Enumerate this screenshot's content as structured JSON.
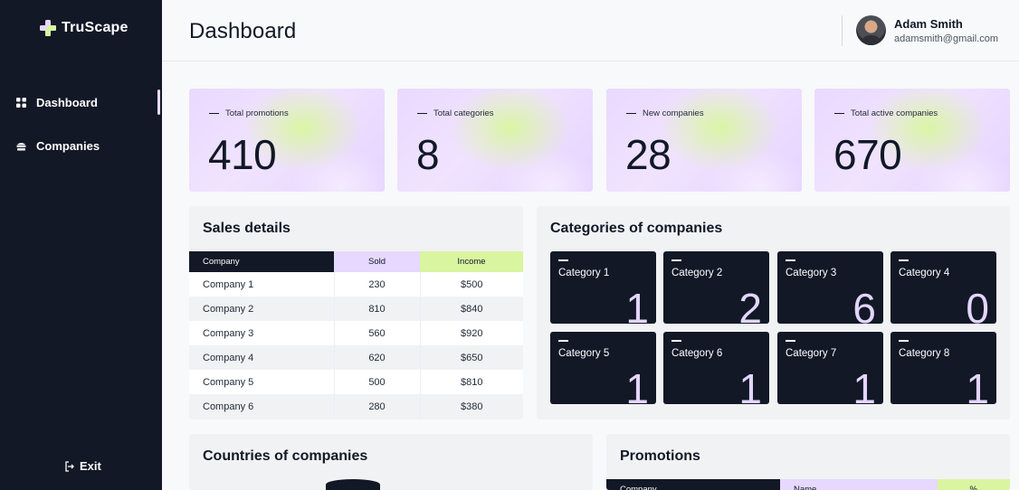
{
  "brand": {
    "name": "TruScape"
  },
  "sidebar": {
    "items": [
      {
        "label": "Dashboard",
        "icon": "grid-icon",
        "active": true
      },
      {
        "label": "Companies",
        "icon": "building-icon",
        "active": false
      }
    ],
    "exit_label": "Exit"
  },
  "header": {
    "title": "Dashboard",
    "user": {
      "name": "Adam Smith",
      "email": "adamsmith@gmail.com"
    }
  },
  "stats": [
    {
      "label": "Total promotions",
      "value": "410"
    },
    {
      "label": "Total categories",
      "value": "8"
    },
    {
      "label": "New companies",
      "value": "28"
    },
    {
      "label": "Total active companies",
      "value": "670"
    }
  ],
  "sales": {
    "title": "Sales details",
    "columns": [
      "Company",
      "Sold",
      "Income"
    ],
    "rows": [
      [
        "Company 1",
        "230",
        "$500"
      ],
      [
        "Company 2",
        "810",
        "$840"
      ],
      [
        "Company 3",
        "560",
        "$920"
      ],
      [
        "Company 4",
        "620",
        "$650"
      ],
      [
        "Company 5",
        "500",
        "$810"
      ],
      [
        "Company 6",
        "280",
        "$380"
      ]
    ]
  },
  "categories": {
    "title": "Categories of companies",
    "items": [
      {
        "label": "Category 1",
        "value": "1"
      },
      {
        "label": "Category 2",
        "value": "2"
      },
      {
        "label": "Category 3",
        "value": "6"
      },
      {
        "label": "Category 4",
        "value": "0"
      },
      {
        "label": "Category 5",
        "value": "1"
      },
      {
        "label": "Category 6",
        "value": "1"
      },
      {
        "label": "Category 7",
        "value": "1"
      },
      {
        "label": "Category 8",
        "value": "1"
      }
    ]
  },
  "countries": {
    "title": "Countries of companies"
  },
  "promotions": {
    "title": "Promotions",
    "columns": [
      "Company",
      "Name",
      "%"
    ]
  },
  "colors": {
    "sidebar_bg": "#121826",
    "accent_lilac": "#e6d8ff",
    "accent_lime": "#d9f5a0"
  }
}
